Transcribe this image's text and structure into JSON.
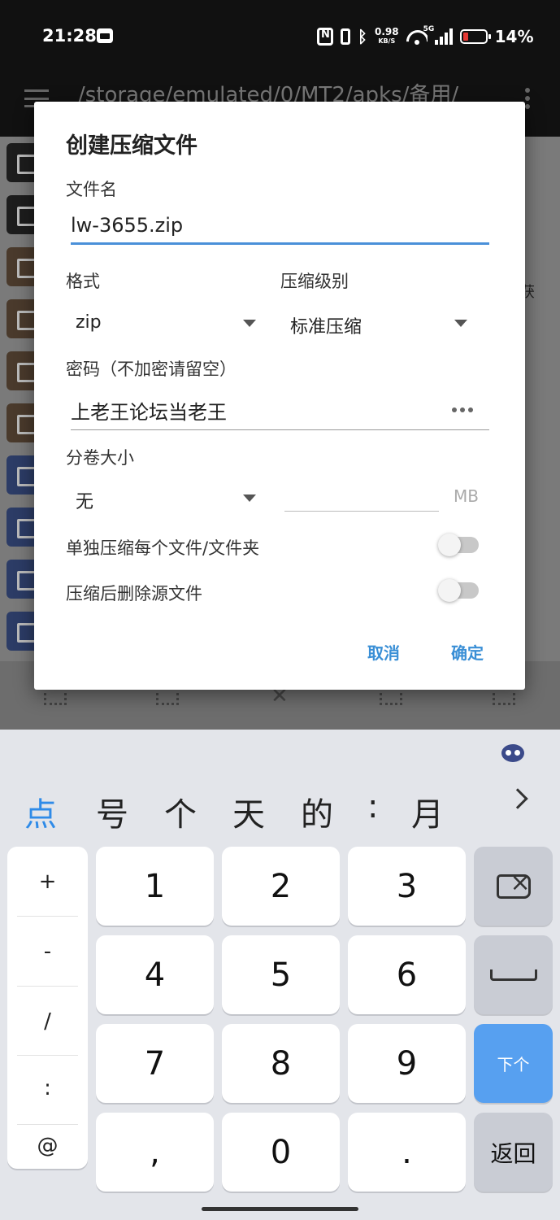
{
  "status": {
    "time": "21:28",
    "net_speed": "0.98",
    "net_unit": "KB/S",
    "network": "5G",
    "battery": "14%",
    "battery_color": "#e53935"
  },
  "appbar": {
    "path": "/storage/emulated/0/MT2/apks/备用/"
  },
  "files": {
    "side_text": "获",
    "icons": [
      "folder",
      "folder",
      "zip",
      "zip",
      "zip",
      "zip",
      "doc",
      "doc",
      "doc",
      "doc"
    ]
  },
  "dialog": {
    "title": "创建压缩文件",
    "filename_label": "文件名",
    "filename_value": "lw-3655.zip",
    "format_label": "格式",
    "format_value": "zip",
    "level_label": "压缩级别",
    "level_value": "标准压缩",
    "password_label": "密码（不加密请留空）",
    "password_value": "上老王论坛当老王",
    "split_label": "分卷大小",
    "split_value": "无",
    "split_unit": "MB",
    "each_label": "单独压缩每个文件/文件夹",
    "each_on": false,
    "delete_label": "压缩后删除源文件",
    "delete_on": false,
    "cancel": "取消",
    "ok": "确定",
    "accent_color": "#4a90d9"
  },
  "keyboard": {
    "candidates": [
      "点",
      "号",
      "个",
      "天",
      "的",
      ":",
      "月"
    ],
    "symbols": [
      "+",
      "-",
      "/",
      ":",
      "@"
    ],
    "digits": [
      "1",
      "2",
      "3",
      "4",
      "5",
      "6",
      "7",
      "8",
      "9",
      ",",
      "0",
      "."
    ],
    "enter_label": "下个",
    "back_label": "返回",
    "enter_color": "#57a0f0"
  }
}
